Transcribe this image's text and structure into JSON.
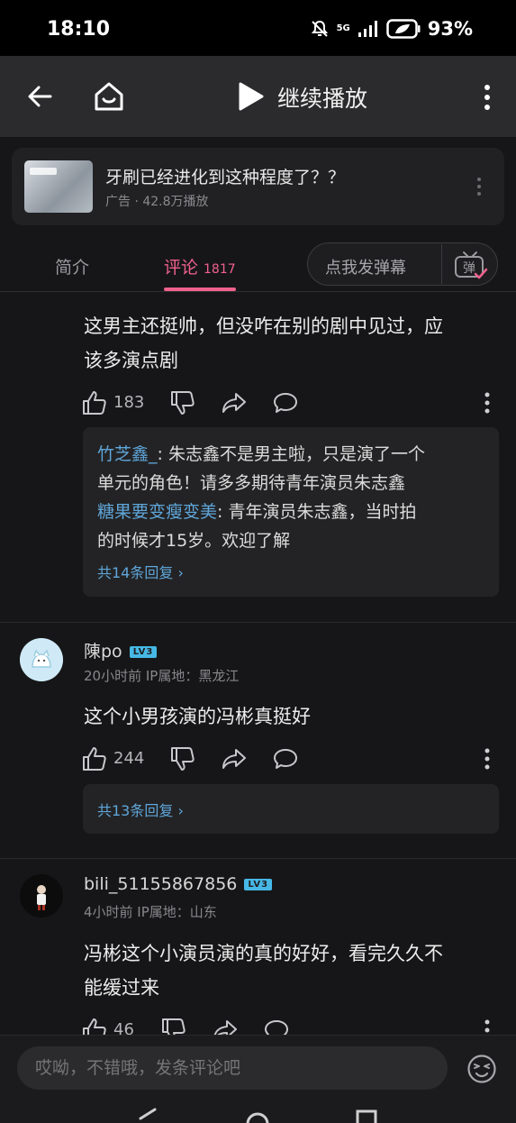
{
  "status_bar": {
    "time": "18:10",
    "network": "5G",
    "battery": "93%"
  },
  "top_nav": {
    "play_label": "继续播放"
  },
  "ad": {
    "title": "牙刷已经进化到这种程度了？？",
    "meta": "广告 · 42.8万播放"
  },
  "tabs": {
    "intro": "简介",
    "comment": "评论",
    "comment_count": "1817",
    "danmu_placeholder": "点我发弹幕",
    "danmu_icon_char": "弹"
  },
  "comments": [
    {
      "text_line1": "这男主还挺帅，但没咋在别的剧中见过，应",
      "text_line2": "该多演点剧",
      "likes": "183",
      "replies": [
        {
          "user": "竹芝鑫_",
          "line1": ": 朱志鑫不是男主啦，只是演了一个",
          "line2": "单元的角色！请多多期待青年演员朱志鑫"
        },
        {
          "user": "糖果要变瘦变美",
          "line1": ": 青年演员朱志鑫，当时拍",
          "line2": "的时候才15岁。欢迎了解"
        }
      ],
      "more_replies": "共14条回复 ›"
    },
    {
      "username": "陳po",
      "level": "LV3",
      "meta": "20小时前 IP属地：黑龙江",
      "text": "这个小男孩演的冯彬真挺好",
      "likes": "244",
      "more_replies": "共13条回复 ›"
    },
    {
      "username": "bili_51155867856",
      "level": "LV3",
      "meta": "4小时前 IP属地：山东",
      "text_line1": "冯彬这个小演员演的真的好好，看完久久不",
      "text_line2": "能缓过来",
      "likes": "46"
    }
  ],
  "bottom": {
    "input_placeholder": "哎呦，不错哦，发条评论吧"
  },
  "colors": {
    "accent": "#f0618e",
    "link": "#5fa6d9",
    "level_badge": "#46b8e6"
  }
}
